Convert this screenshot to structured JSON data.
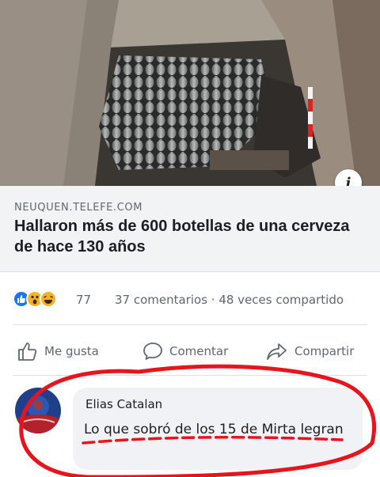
{
  "post": {
    "info_icon_glyph": "i",
    "link": {
      "domain": "NEUQUEN.TELEFE.COM",
      "title": "Hallaron más de 600 botellas de una cerveza de hace 130 años"
    },
    "reactions": {
      "icons": [
        "like",
        "wow",
        "haha"
      ],
      "count": "77",
      "meta": "37 comentarios · 48 veces compartido"
    },
    "actions": {
      "like_label": "Me gusta",
      "comment_label": "Comentar",
      "share_label": "Compartir"
    },
    "comment": {
      "author": "Elias Catalan",
      "text": "Lo que sobró de los 15 de Mirta legran"
    }
  },
  "colors": {
    "accent": "#1877f2",
    "annotation": "#e8141c",
    "muted_text": "#606770",
    "link_box_bg": "#f2f3f5",
    "bubble_bg": "#f0f2f5"
  }
}
